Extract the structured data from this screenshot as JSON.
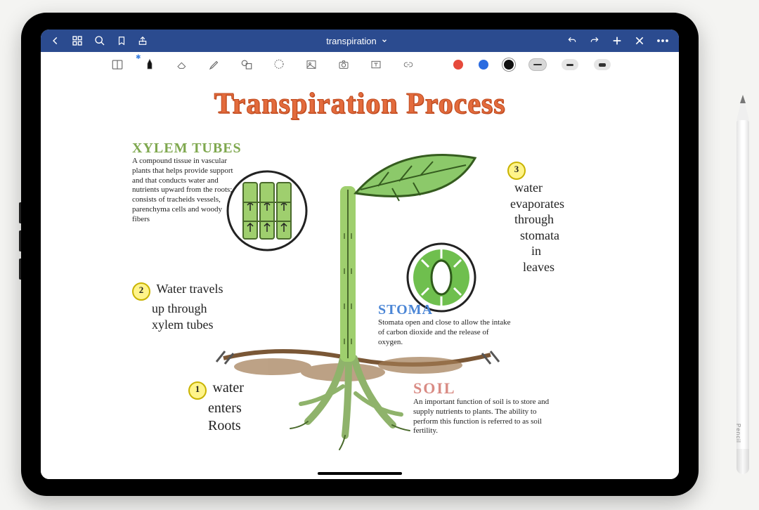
{
  "titlebar": {
    "document_name": "transpiration"
  },
  "toolbar": {
    "colors": {
      "red": "#e64a3b",
      "blue": "#2a6be0",
      "black": "#111111"
    }
  },
  "canvas": {
    "main_title": "Transpiration Process",
    "sections": {
      "xylem": {
        "heading": "XYLEM TUBES",
        "body": "A compound tissue in vascular plants that helps provide support and that conducts water and nutrients upward from the roots; consists of tracheids vessels, parenchyma cells and woody fibers"
      },
      "stoma": {
        "heading": "STOMA",
        "body": "Stomata open and close to allow the intake of carbon dioxide and the release of oxygen."
      },
      "soil": {
        "heading": "SOIL",
        "body": "An important function of soil is to store and supply nutrients to plants. The ability to perform this function is referred to as soil fertility."
      }
    },
    "steps": {
      "one": {
        "num": "1",
        "text_l1": "water",
        "text_l2": "enters",
        "text_l3": "Roots"
      },
      "two": {
        "num": "2",
        "text_l1": "Water travels",
        "text_l2": "up through",
        "text_l3": "xylem tubes"
      },
      "three": {
        "num": "3",
        "text_l1": "water",
        "text_l2": "evaporates",
        "text_l3": "through",
        "text_l4": "stomata",
        "text_l5": "in",
        "text_l6": "leaves"
      }
    }
  },
  "pencil": {
    "brand": "Pencil"
  }
}
